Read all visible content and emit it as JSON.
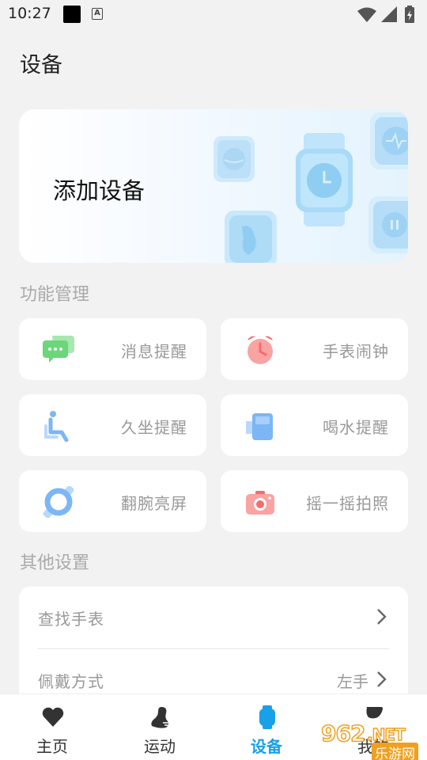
{
  "status_bar": {
    "time": "10:27",
    "notif_letter": "A"
  },
  "page": {
    "title": "设备"
  },
  "banner": {
    "label": "添加设备"
  },
  "features": {
    "title": "功能管理",
    "items": [
      {
        "label": "消息提醒",
        "icon": "message-bubbles-icon",
        "color": "#6bd67a"
      },
      {
        "label": "手表闹钟",
        "icon": "alarm-clock-icon",
        "color": "#f26d6d"
      },
      {
        "label": "久坐提醒",
        "icon": "sitting-person-icon",
        "color": "#7cb6f5"
      },
      {
        "label": "喝水提醒",
        "icon": "water-cup-icon",
        "color": "#7cb6f5"
      },
      {
        "label": "翻腕亮屏",
        "icon": "wrist-flip-icon",
        "color": "#7cb6f5"
      },
      {
        "label": "摇一摇拍照",
        "icon": "camera-icon",
        "color": "#f26d6d"
      }
    ]
  },
  "other": {
    "title": "其他设置",
    "rows": [
      {
        "label": "查找手表",
        "value": ""
      },
      {
        "label": "佩戴方式",
        "value": "左手"
      }
    ]
  },
  "tabbar": {
    "accent": "#1aa0e8",
    "tabs": [
      {
        "label": "主页",
        "icon": "heart-icon"
      },
      {
        "label": "运动",
        "icon": "running-shoe-icon"
      },
      {
        "label": "设备",
        "icon": "watch-icon",
        "active": true
      },
      {
        "label": "我的",
        "icon": "user-icon"
      }
    ]
  },
  "watermark": {
    "number": "962",
    "suffix": ".NET",
    "site": "乐游网"
  }
}
